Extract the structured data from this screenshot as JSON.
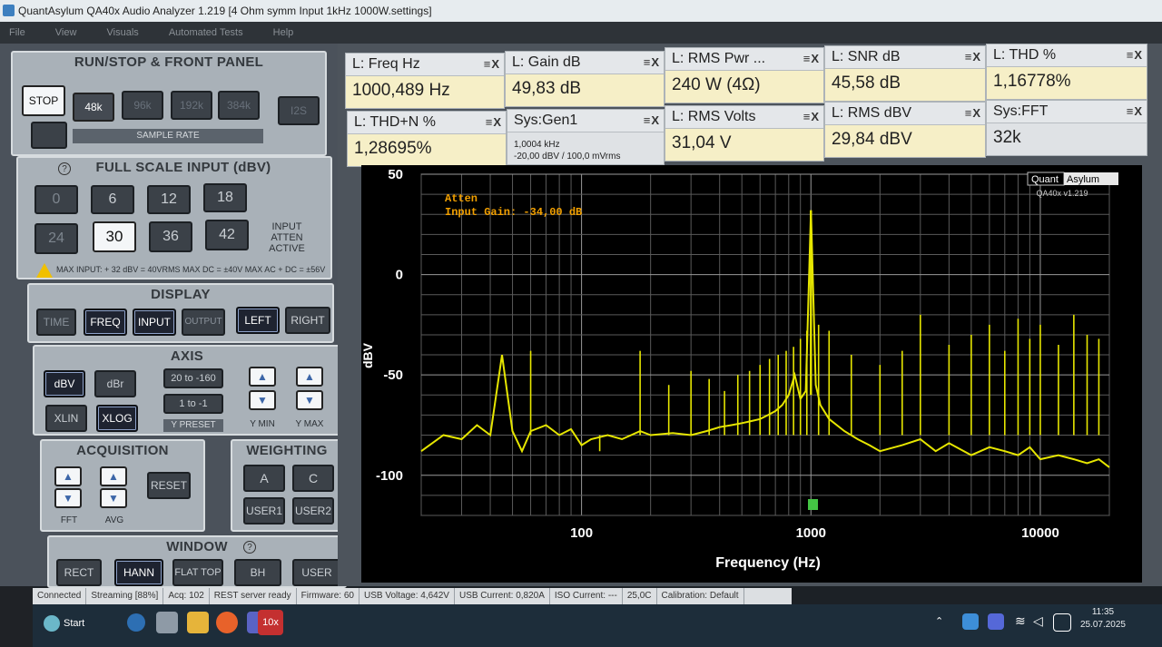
{
  "window": {
    "title": "QuantAsylum QA40x Audio Analyzer 1.219 [4 Ohm symm Input 1kHz 1000W.settings]"
  },
  "menu": [
    "File",
    "View",
    "Visuals",
    "Automated Tests",
    "Help"
  ],
  "run_stop": {
    "title": "RUN/STOP & FRONT PANEL",
    "stop_label": "STOP",
    "sample_rates": [
      "48k",
      "96k",
      "192k",
      "384k"
    ],
    "selected_rate": "48k",
    "sample_rate_label": "SAMPLE RATE",
    "i2s_label": "I2S"
  },
  "full_scale": {
    "title": "FULL SCALE INPUT (dBV)",
    "help": "?",
    "values": [
      "0",
      "6",
      "12",
      "18",
      "24",
      "30",
      "36",
      "42"
    ],
    "selected": "30",
    "atten_label": "INPUT ATTEN ACTIVE",
    "warning": "MAX INPUT: + 32 dBV = 40VRMS     MAX DC = ±40V     MAX AC + DC = ±56V"
  },
  "display": {
    "title": "DISPLAY",
    "buttons": [
      "TIME",
      "FREQ",
      "INPUT",
      "OUTPUT",
      "LEFT",
      "RIGHT"
    ]
  },
  "axis": {
    "title": "AXIS",
    "dbv": "dBV",
    "dbr": "dBr",
    "xlin": "XLIN",
    "xlog": "XLOG",
    "preset1": "20 to -160",
    "preset2": "1 to -1",
    "y_preset_label": "Y PRESET",
    "y_min_label": "Y MIN",
    "y_max_label": "Y MAX",
    "up": "▲",
    "down": "▼"
  },
  "acquisition": {
    "title": "ACQUISITION",
    "reset": "RESET",
    "fft_label": "FFT",
    "avg_label": "AVG"
  },
  "weighting": {
    "title": "WEIGHTING",
    "buttons": [
      "A",
      "C",
      "USER1",
      "USER2"
    ]
  },
  "window_fn": {
    "title": "WINDOW",
    "help": "?",
    "buttons": [
      "RECT",
      "HANN",
      "FLAT TOP",
      "BH",
      "USER"
    ]
  },
  "measurements": [
    {
      "label": "L: Freq Hz",
      "value": "1000,489 Hz"
    },
    {
      "label": "L: Gain dB",
      "value": "49,83 dB"
    },
    {
      "label": "L: RMS Pwr ...",
      "value": "240 W (4Ω)"
    },
    {
      "label": "L: SNR dB",
      "value": "45,58 dB"
    },
    {
      "label": "L: THD %",
      "value": "1,16778%"
    },
    {
      "label": "L: THD+N %",
      "value": "1,28695%"
    },
    {
      "label": "Sys:Gen1",
      "value": "1,0004 kHz",
      "value2": "-20,00 dBV  /  100,0 mVrms"
    },
    {
      "label": "L: RMS Volts",
      "value": "31,04 V"
    },
    {
      "label": "L: RMS dBV",
      "value": "29,84 dBV"
    },
    {
      "label": "Sys:FFT",
      "value": "32k"
    }
  ],
  "meas_icons": "≡X",
  "plot": {
    "annotation1": "Atten",
    "annotation2": "Input Gain: -34,00 dB",
    "logo1": "Quant",
    "logo2": "Asylum",
    "logo_version": "QA40x v1.219",
    "xlabel": "Frequency (Hz)",
    "ylabel": "dBV"
  },
  "chart_data": {
    "type": "line",
    "xlabel": "Frequency (Hz)",
    "ylabel": "dBV",
    "x_scale": "log",
    "xlim": [
      20,
      20000
    ],
    "ylim": [
      -120,
      50
    ],
    "x_ticks": [
      "100",
      "1000",
      "10000"
    ],
    "y_ticks": [
      "50",
      "0",
      "-50",
      "-100"
    ],
    "grid": true,
    "series": [
      {
        "color": "#e6e600",
        "x": [
          20,
          25,
          30,
          35,
          40,
          45,
          50,
          55,
          60,
          70,
          80,
          90,
          100,
          110,
          130,
          150,
          180,
          200,
          250,
          300,
          350,
          400,
          450,
          500,
          550,
          600,
          650,
          700,
          750,
          800,
          850,
          900,
          950,
          1000,
          1050,
          1100,
          1200,
          1400,
          1600,
          1800,
          2000,
          2500,
          3000,
          3500,
          4000,
          5000,
          6000,
          7000,
          8000,
          9000,
          10000,
          12000,
          14000,
          16000,
          18000,
          20000
        ],
        "y": [
          -88,
          -80,
          -82,
          -75,
          -80,
          -40,
          -78,
          -88,
          -78,
          -75,
          -80,
          -77,
          -85,
          -82,
          -80,
          -82,
          -78,
          -80,
          -79,
          -80,
          -78,
          -76,
          -75,
          -74,
          -73,
          -72,
          -70,
          -68,
          -65,
          -60,
          -50,
          -62,
          -58,
          32,
          -55,
          -65,
          -72,
          -78,
          -82,
          -85,
          -88,
          -85,
          -82,
          -88,
          -84,
          -90,
          -86,
          -88,
          -90,
          -86,
          -92,
          -90,
          -92,
          -94,
          -92,
          -96
        ]
      }
    ],
    "harmonics": {
      "x": [
        60,
        120,
        180,
        240,
        300,
        360,
        420,
        480,
        540,
        600,
        660,
        720,
        780,
        840,
        900,
        960,
        1080,
        1200,
        1500,
        2000,
        2500,
        3000,
        4000,
        5000,
        6000,
        7000,
        8000,
        9000,
        10000,
        12000,
        14000,
        16000,
        18000
      ],
      "y": [
        -38,
        -88,
        -38,
        -55,
        -48,
        -52,
        -58,
        -50,
        -48,
        -45,
        -42,
        -40,
        -38,
        -36,
        -32,
        -28,
        -25,
        -28,
        -40,
        -45,
        -38,
        -20,
        -35,
        -30,
        -25,
        -38,
        -22,
        -32,
        -25,
        -35,
        -20,
        -30,
        -32
      ]
    }
  },
  "status": [
    "Connected",
    "Streaming [88%]",
    "Acq: 102",
    "REST server ready",
    "Firmware: 60",
    "USB Voltage: 4,642V",
    "USB Current: 0,820A",
    "ISO Current: ---",
    "25,0C",
    "Calibration: Default"
  ],
  "taskbar": {
    "start": "Start",
    "app_label": "10x",
    "time": "11:35",
    "date": "25.07.2025"
  }
}
